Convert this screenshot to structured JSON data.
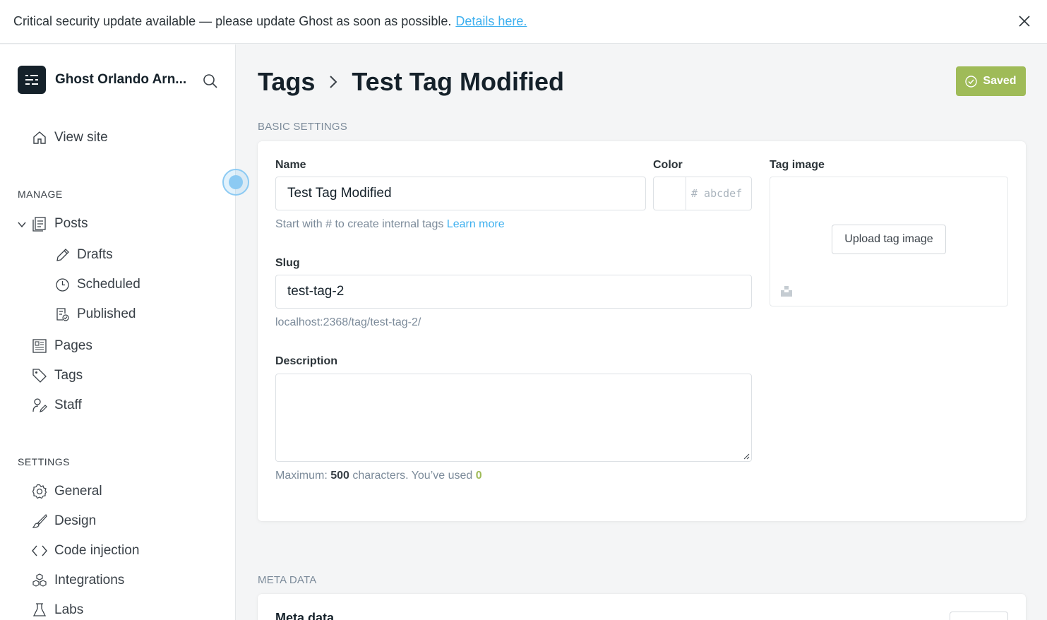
{
  "banner": {
    "message": "Critical security update available — please update Ghost as soon as possible.",
    "link_text": "Details here."
  },
  "sidebar": {
    "site_name": "Ghost Orlando Arn...",
    "view_site": "View site",
    "manage_label": "MANAGE",
    "posts": "Posts",
    "drafts": "Drafts",
    "scheduled": "Scheduled",
    "published": "Published",
    "pages": "Pages",
    "tags": "Tags",
    "staff": "Staff",
    "settings_label": "SETTINGS",
    "general": "General",
    "design": "Design",
    "code_injection": "Code injection",
    "integrations": "Integrations",
    "labs": "Labs"
  },
  "header": {
    "crumb_parent": "Tags",
    "crumb_current": "Test Tag Modified",
    "saved_label": "Saved"
  },
  "basic": {
    "section_title": "BASIC SETTINGS",
    "name_label": "Name",
    "name_value": "Test Tag Modified",
    "name_hint": "Start with # to create internal tags",
    "learn_more": "Learn more",
    "color_label": "Color",
    "color_placeholder": "# abcdef",
    "image_label": "Tag image",
    "upload_label": "Upload tag image",
    "slug_label": "Slug",
    "slug_value": "test-tag-2",
    "slug_url": "localhost:2368/tag/test-tag-2/",
    "description_label": "Description",
    "counter_prefix": "Maximum:",
    "counter_max": "500",
    "counter_mid": "characters. You’ve used",
    "counter_used": "0"
  },
  "meta": {
    "section_title": "META DATA",
    "card_title": "Meta data"
  },
  "colors": {
    "accent": "#3eb0ef",
    "saved_green": "#9fbb58",
    "dark": "#15212a"
  }
}
